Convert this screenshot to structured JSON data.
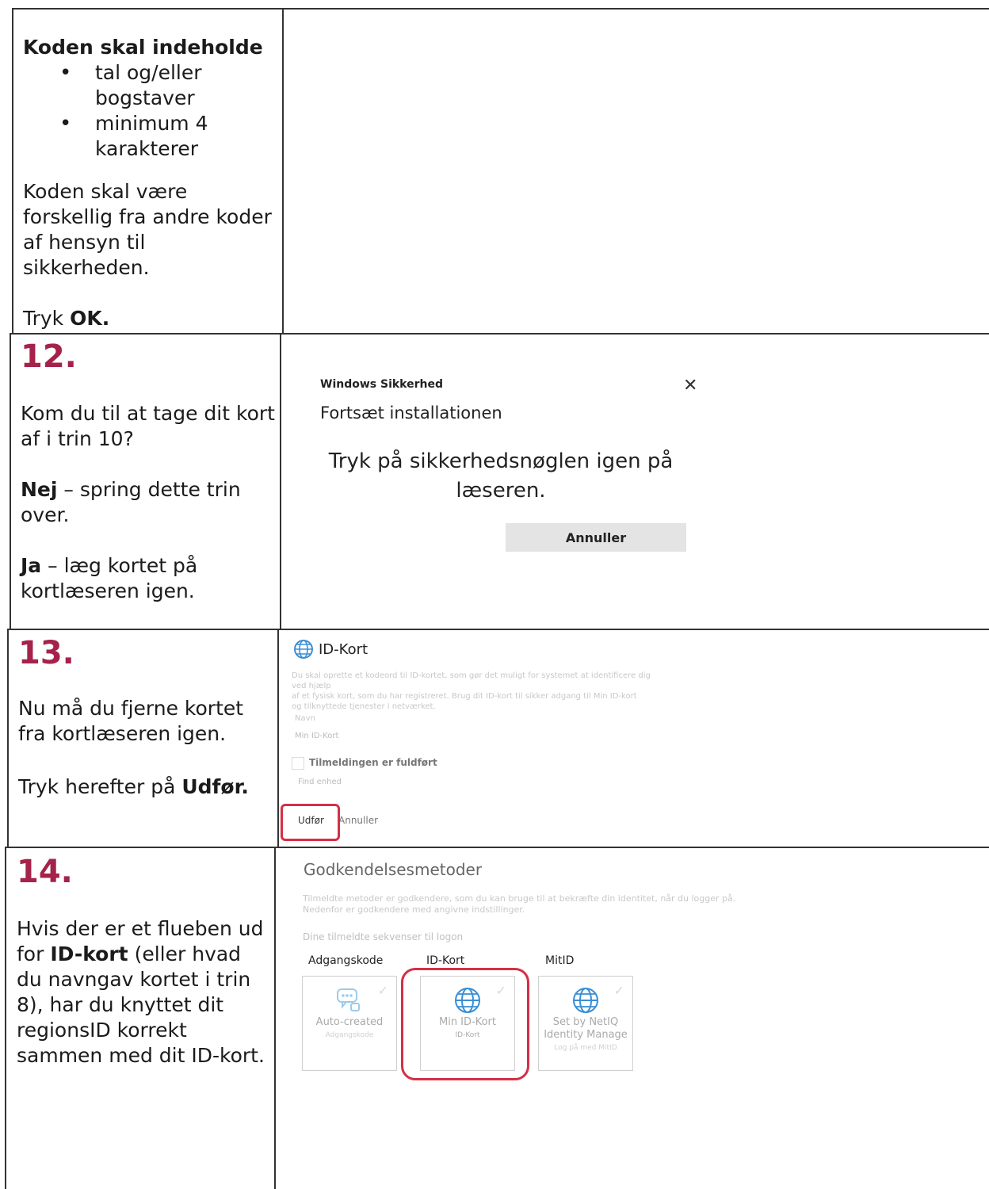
{
  "row11": {
    "heading": "Koden skal indeholde",
    "bullets": [
      "tal og/eller bogstaver",
      "minimum 4 karakterer"
    ],
    "para": "Koden skal være forskellig fra andre koder af hensyn til sikkerheden.",
    "tryk_prefix": "Tryk ",
    "tryk_bold": "OK."
  },
  "row12": {
    "number": "12.",
    "question": "Kom du til at tage dit kort af i trin 10?",
    "no_bold": "Nej",
    "no_text": " – spring dette trin over.",
    "yes_bold": "Ja",
    "yes_text": " – læg kortet på kortlæseren igen.",
    "dialog": {
      "app_title": "Windows Sikkerhed",
      "close": "✕",
      "heading": "Fortsæt installationen",
      "message": "Tryk på sikkerhedsnøglen igen på læseren.",
      "cancel": "Annuller"
    }
  },
  "row13": {
    "number": "13.",
    "text1": "Nu må du fjerne kortet fra kortlæseren igen.",
    "text2_prefix": "Tryk herefter på ",
    "text2_bold": "Udfør.",
    "screen": {
      "title": "ID-Kort",
      "desc_line1": "Du skal oprette et kodeord til ID-kortet, som gør det muligt for systemet at identificere dig ved hjælp",
      "desc_line2": "af et fysisk kort, som du har registreret. Brug dit ID-kort til sikker adgang til Min ID-kort",
      "desc_line3": "og tilknyttede tjenester i netværket.",
      "field_label": "Navn",
      "field_value": "Min ID-Kort",
      "done": "Tilmeldingen er fuldført",
      "device": "Find enhed",
      "finish": "Udfør",
      "cancel": "Annuller"
    }
  },
  "row14": {
    "number": "14.",
    "p1": "Hvis der er et flueben ud for ",
    "bold": "ID-kort",
    "p2": " (eller hvad du navngav kortet i trin 8), har du knyttet dit regionsID korrekt sammen med dit ID-kort.",
    "screen": {
      "title": "Godkendelsesmetoder",
      "desc_line1": "Tilmeldte metoder er godkendere, som du kan bruge til at bekræfte din identitet, når du logger på.",
      "desc_line2": "Nedenfor er godkendere med angivne indstillinger.",
      "seq": "Dine tilmeldte sekvenser til logon",
      "cards": [
        {
          "label": "Adgangskode",
          "title": "Auto-created",
          "sub": "Adgangskode",
          "icon": "chat-key-icon"
        },
        {
          "label": "ID-Kort",
          "title": "Min ID-Kort",
          "sub": "ID-Kort",
          "icon": "globe-icon"
        },
        {
          "label": "MitID",
          "title": "Set by NetIQ Identity Manage",
          "sub": "Log på med MitID",
          "icon": "globe-icon"
        }
      ]
    }
  }
}
